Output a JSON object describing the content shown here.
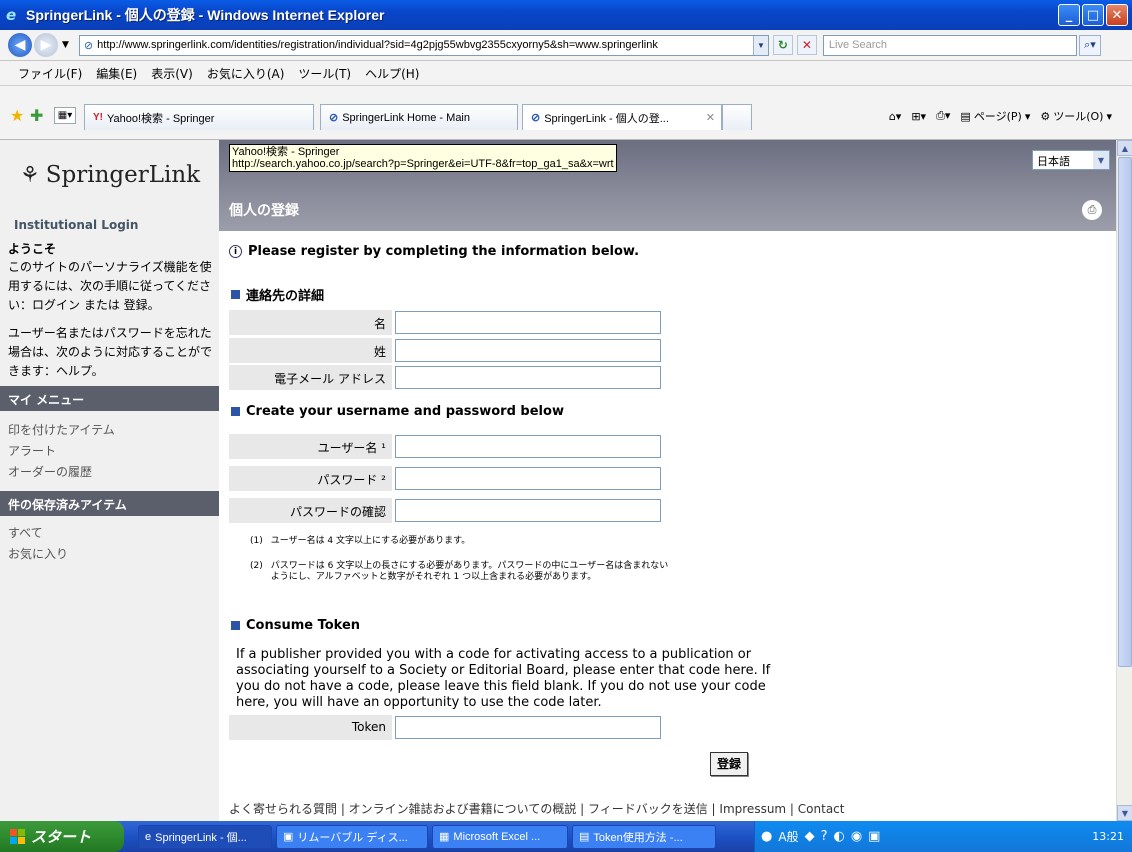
{
  "window": {
    "title": "SpringerLink - 個人の登録 - Windows Internet Explorer",
    "url": "http://www.springerlink.com/identities/registration/individual?sid=4g2pjg55wbvg2355cxyorny5&sh=www.springerlink",
    "search_placeholder": "Live Search"
  },
  "menu": [
    "ファイル(F)",
    "編集(E)",
    "表示(V)",
    "お気に入り(A)",
    "ツール(T)",
    "ヘルプ(H)"
  ],
  "tabs": [
    {
      "label": "Yahoo!検索 - Springer"
    },
    {
      "label": "SpringerLink Home - Main"
    },
    {
      "label": "SpringerLink - 個人の登..."
    }
  ],
  "toolbar": {
    "page_label": "ページ(P)",
    "tools_label": "ツール(O)"
  },
  "tooltip": "Yahoo!検索 - Springer\nhttp://search.yahoo.co.jp/search?p=Springer&ei=UTF-8&fr=top_ga1_sa&x=wrt",
  "sidebar": {
    "logo": "SpringerLink",
    "institutional_login": "Institutional Login",
    "welcome": "ようこそ",
    "text1": "このサイトのパーソナライズ機能を使用するには、次の手順に従ってください：ログイン または 登録。",
    "text2": "ユーザー名またはパスワードを忘れた場合は、次のように対応することができます：ヘルプ。",
    "my_menu": "マイ メニュー",
    "my_menu_items": [
      "印を付けたアイテム",
      "アラート",
      "オーダーの履歴"
    ],
    "saved_header": "件の保存済みアイテム",
    "saved_items": [
      "すべて",
      "お気に入り"
    ]
  },
  "header": {
    "title": "個人の登録",
    "language": "日本語"
  },
  "main": {
    "notice": "Please register by completing the information below.",
    "contact_section": "連絡先の詳細",
    "contact_fields": [
      "名",
      "姓",
      "電子メール アドレス"
    ],
    "account_section": "Create your username and password below",
    "account_fields": [
      "ユーザー名 ¹",
      "パスワード ²",
      "パスワードの確認"
    ],
    "note1_num": "(1)",
    "note1": "ユーザー名は 4 文字以上にする必要があります。",
    "note2_num": "(2)",
    "note2": "パスワードは 6 文字以上の長さにする必要があります。パスワードの中にユーザー名は含まれないようにし、アルファベットと数字がそれぞれ 1 つ以上含まれる必要があります。",
    "token_section": "Consume Token",
    "token_text": "If a publisher provided you with a code for activating access to a publication or associating yourself to a Society or Editorial Board, please enter that code here. If you do not have a code, please leave this field blank. If you do not use your code here, you will have an opportunity to use the code later.",
    "token_label": "Token",
    "submit": "登録",
    "footer": "よく寄せられる質問 | オンライン雑誌および書籍についての概説 | フィードバックを送信 | Impressum | Contact"
  },
  "taskbar": {
    "start": "スタート",
    "tasks": [
      "SpringerLink - 個...",
      "リムーバブル ディス...",
      "Microsoft Excel ...",
      "Token使用方法 -..."
    ],
    "tray_text": "A般",
    "clock": "13:21"
  }
}
